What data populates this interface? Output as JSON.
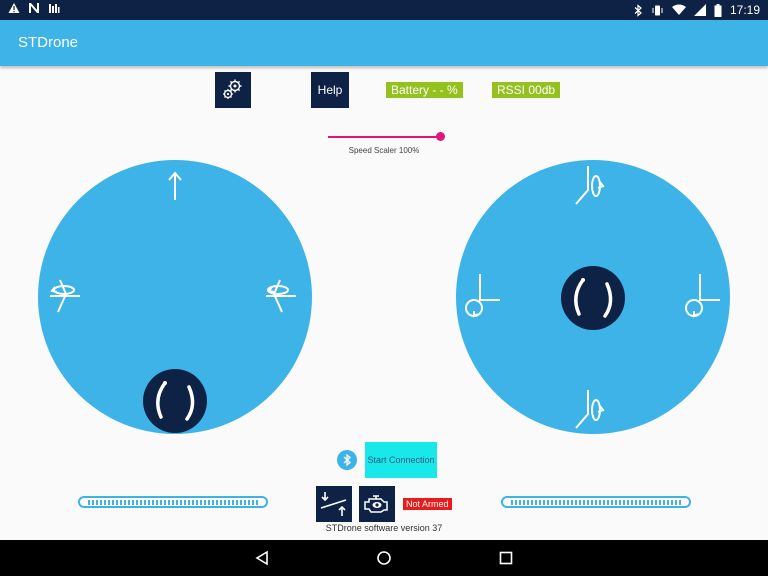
{
  "app": {
    "title": "STDrone"
  },
  "status_bar": {
    "time": "17:19"
  },
  "toolbar": {
    "help_label": "Help"
  },
  "telemetry": {
    "battery_label": "Battery - - %",
    "rssi_label": "RSSI 00db"
  },
  "speed_scaler": {
    "label": "Speed Scaler 100%",
    "value_percent": 100
  },
  "connection": {
    "start_label": "Start Connection"
  },
  "arming": {
    "status_label": "Not Armed"
  },
  "footer": {
    "version_label": "STDrone software version 37"
  },
  "colors": {
    "accent": "#3db3e8",
    "dark": "#0e2245",
    "badge_green": "#95c11f",
    "slider": "#e0157b",
    "start_button": "#19e8ea",
    "not_armed": "#e81c1c"
  },
  "icons": [
    "warning-icon",
    "n-icon",
    "signal-bars-icon",
    "bluetooth-icon",
    "phone-vibrate-icon",
    "wifi-icon",
    "cell-signal-icon",
    "battery-icon",
    "gears-icon",
    "arrow-up-icon",
    "yaw-left-icon",
    "yaw-right-icon",
    "pitch-up-icon",
    "pitch-down-icon",
    "roll-left-icon",
    "roll-right-icon",
    "takeoff-icon",
    "engine-icon",
    "back-icon",
    "home-icon",
    "recents-icon"
  ]
}
